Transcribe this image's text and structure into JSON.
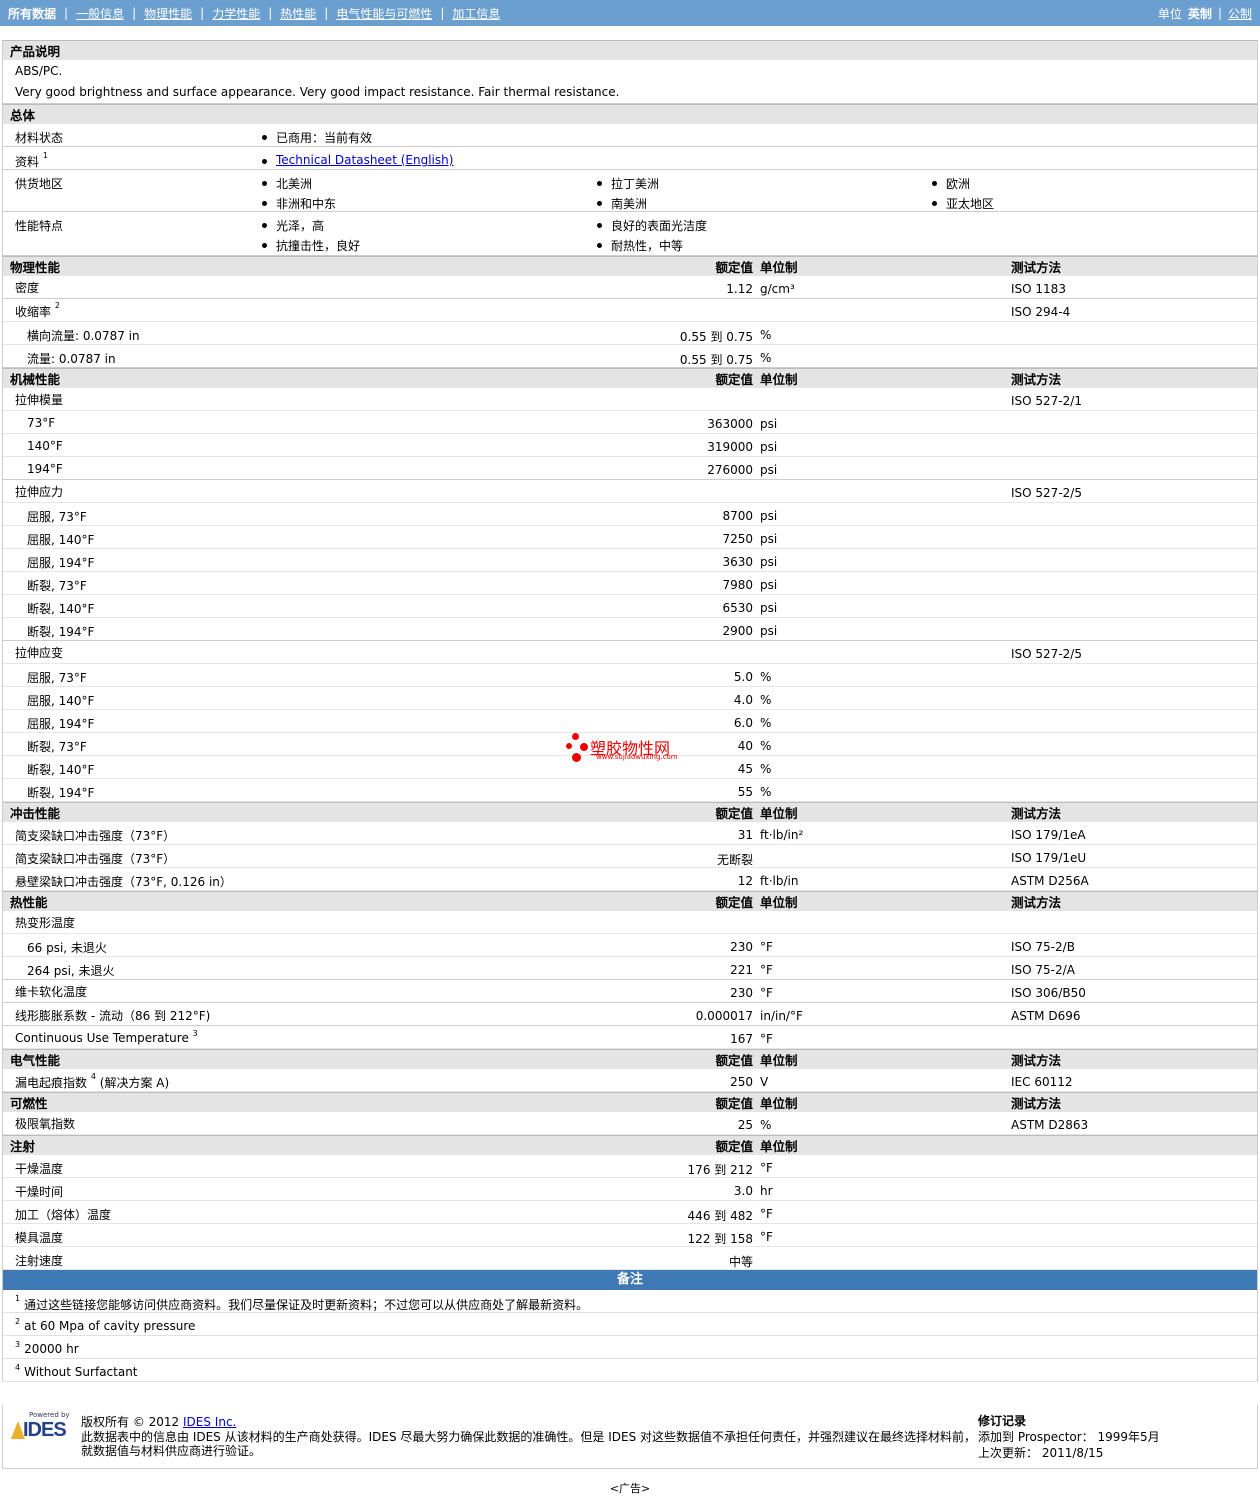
{
  "nav": {
    "tabs": [
      "所有数据",
      "一般信息",
      "物理性能",
      "力学性能",
      "热性能",
      "电气性能与可燃性",
      "加工信息"
    ],
    "unit_label": "单位",
    "unit_active": "英制",
    "unit_other": "公制",
    "separator": "|"
  },
  "product": {
    "title": "产品说明",
    "line1": "ABS/PC.",
    "line2": "Very good brightness and surface appearance. Very good impact resistance. Fair thermal resistance."
  },
  "general": {
    "title": "总体",
    "status_label": "材料状态",
    "status_value": "已商用：当前有效",
    "source_label": "资料",
    "source_sup": "1",
    "source_link": "Technical Datasheet (English)",
    "supply_label": "供货地区",
    "supply": [
      "北美洲",
      "拉丁美洲",
      "欧洲",
      "非洲和中东",
      "南美洲",
      "亚太地区"
    ],
    "features_label": "性能特点",
    "features": [
      "光泽，高",
      "良好的表面光洁度",
      "抗撞击性，良好",
      "耐热性，中等"
    ]
  },
  "headers": {
    "value": "额定值",
    "unit": "单位制",
    "method": "测试方法"
  },
  "physical": {
    "title": "物理性能",
    "density_label": "密度",
    "density_value": "1.12",
    "density_unit": "g/cm³",
    "density_method": "ISO 1183",
    "shrink_label": "收缩率",
    "shrink_sup": "2",
    "shrink_method": "ISO 294-4",
    "shrink_rows": [
      {
        "label": "横向流量: 0.0787 in",
        "value": "0.55 到  0.75",
        "unit": "%"
      },
      {
        "label": "流量: 0.0787 in",
        "value": "0.55 到  0.75",
        "unit": "%"
      }
    ]
  },
  "mechanical": {
    "title": "机械性能",
    "modulus_label": "拉伸模量",
    "modulus_method": "ISO 527-2/1",
    "modulus_rows": [
      {
        "label": "73°F",
        "value": "363000",
        "unit": "psi"
      },
      {
        "label": "140°F",
        "value": "319000",
        "unit": "psi"
      },
      {
        "label": "194°F",
        "value": "276000",
        "unit": "psi"
      }
    ],
    "stress_label": "拉伸应力",
    "stress_method": "ISO 527-2/5",
    "stress_rows": [
      {
        "label": "屈服, 73°F",
        "value": "8700",
        "unit": "psi"
      },
      {
        "label": "屈服, 140°F",
        "value": "7250",
        "unit": "psi"
      },
      {
        "label": "屈服, 194°F",
        "value": "3630",
        "unit": "psi"
      },
      {
        "label": "断裂, 73°F",
        "value": "7980",
        "unit": "psi"
      },
      {
        "label": "断裂, 140°F",
        "value": "6530",
        "unit": "psi"
      },
      {
        "label": "断裂, 194°F",
        "value": "2900",
        "unit": "psi"
      }
    ],
    "strain_label": "拉伸应变",
    "strain_method": "ISO 527-2/5",
    "strain_rows": [
      {
        "label": "屈服, 73°F",
        "value": "5.0",
        "unit": "%"
      },
      {
        "label": "屈服, 140°F",
        "value": "4.0",
        "unit": "%"
      },
      {
        "label": "屈服, 194°F",
        "value": "6.0",
        "unit": "%"
      },
      {
        "label": "断裂, 73°F",
        "value": "40",
        "unit": "%"
      },
      {
        "label": "断裂, 140°F",
        "value": "45",
        "unit": "%"
      },
      {
        "label": "断裂, 194°F",
        "value": "55",
        "unit": "%"
      }
    ]
  },
  "impact": {
    "title": "冲击性能",
    "rows": [
      {
        "label": "简支梁缺口冲击强度（73°F）",
        "value": "31",
        "unit": "ft·lb/in²",
        "method": "ISO 179/1eA"
      },
      {
        "label": "简支梁缺口冲击强度（73°F）",
        "value": "无断裂",
        "unit": "",
        "method": "ISO 179/1eU"
      },
      {
        "label": "悬壁梁缺口冲击强度（73°F, 0.126 in）",
        "value": "12",
        "unit": "ft·lb/in",
        "method": "ASTM D256A"
      }
    ]
  },
  "thermal": {
    "title": "热性能",
    "hdt_label": "热变形温度",
    "hdt_rows": [
      {
        "label": "66 psi, 未退火",
        "value": "230",
        "unit": "°F",
        "method": "ISO 75-2/B"
      },
      {
        "label": "264 psi, 未退火",
        "value": "221",
        "unit": "°F",
        "method": "ISO 75-2/A"
      }
    ],
    "vicat_label": "维卡软化温度",
    "vicat_value": "230",
    "vicat_unit": "°F",
    "vicat_method": "ISO 306/B50",
    "clte_label": "线形膨胀系数 - 流动（86 到  212°F)",
    "clte_value": "0.000017",
    "clte_unit": "in/in/°F",
    "clte_method": "ASTM D696",
    "cut_label": "Continuous Use Temperature",
    "cut_sup": "3",
    "cut_value": "167",
    "cut_unit": "°F"
  },
  "electrical": {
    "title": "电气性能",
    "cti_label": "漏电起痕指数",
    "cti_sup": "4",
    "cti_suffix": "(解决方案  A)",
    "cti_value": "250",
    "cti_unit": "V",
    "cti_method": "IEC 60112"
  },
  "flammability": {
    "title": "可燃性",
    "loi_label": "极限氧指数",
    "loi_value": "25",
    "loi_unit": "%",
    "loi_method": "ASTM D2863"
  },
  "injection": {
    "title": "注射",
    "rows": [
      {
        "label": "干燥温度",
        "value": "176 到  212",
        "unit": "°F"
      },
      {
        "label": "干燥时间",
        "value": "3.0",
        "unit": "hr"
      },
      {
        "label": "加工（熔体）温度",
        "value": "446 到  482",
        "unit": "°F"
      },
      {
        "label": "模具温度",
        "value": "122 到  158",
        "unit": "°F"
      },
      {
        "label": "注射速度",
        "value": "中等",
        "unit": ""
      }
    ]
  },
  "notes": {
    "title": "备注",
    "items": [
      {
        "n": "1",
        "text": "通过这些链接您能够访问供应商资料。我们尽量保证及时更新资料；不过您可以从供应商处了解最新资料。"
      },
      {
        "n": "2",
        "text": "at 60 Mpa of cavity pressure"
      },
      {
        "n": "3",
        "text": "20000 hr"
      },
      {
        "n": "4",
        "text": "Without Surfactant"
      }
    ]
  },
  "watermark": {
    "text": "塑胶物性网",
    "url": "www.sujiaowuxing.com"
  },
  "footer": {
    "powered": "Powered by",
    "logo": "IDES",
    "copyright_pre": "版权所有  © 2012",
    "copyright_link": "IDES Inc.",
    "disclaimer1": "此数据表中的信息由  IDES 从该材料的生产商处获得。IDES 尽最大努力确保此数据的准确性。但是  IDES 对这些数据值不承担任何责任，并强烈建议在最终选择材料前，",
    "disclaimer2": "就数据值与材料供应商进行验证。",
    "rev_title": "修订记录",
    "rev_added": "添加到  Prospector：   1999年5月",
    "rev_updated": "上次更新：   2011/8/15"
  },
  "ad": "<广告>"
}
